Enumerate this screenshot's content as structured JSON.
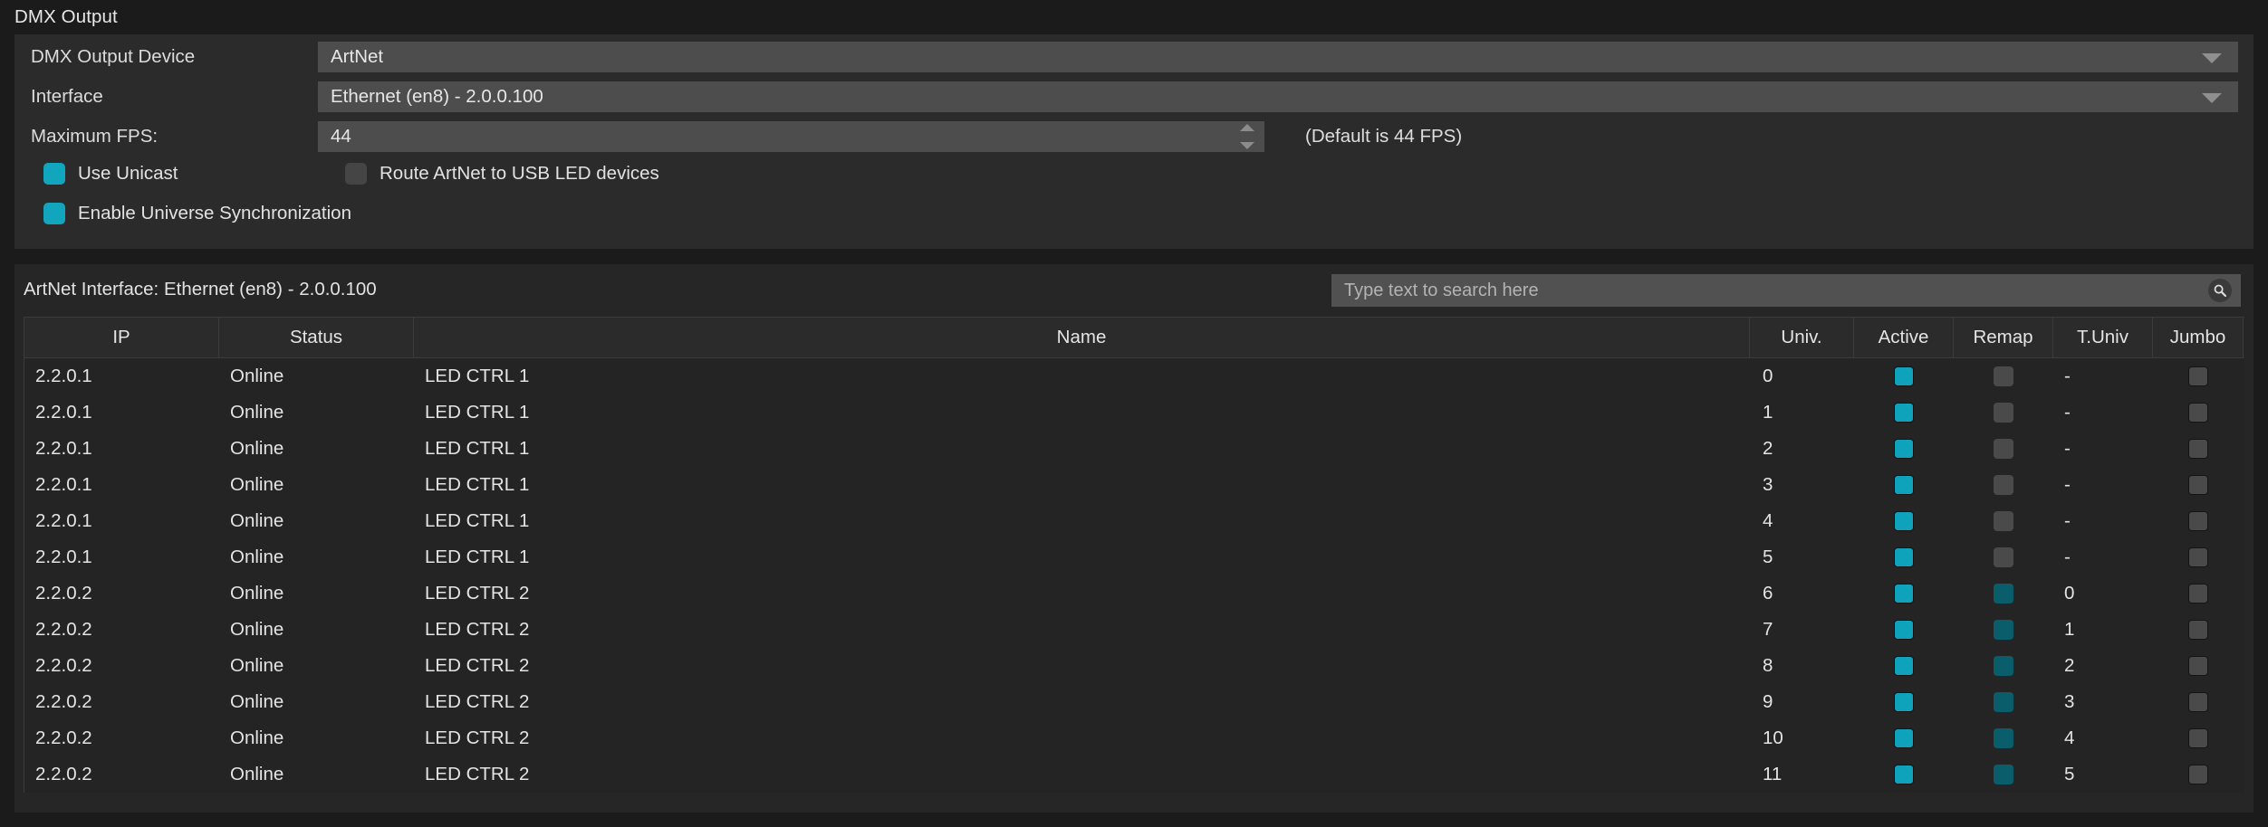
{
  "window": {
    "title": "DMX Output"
  },
  "settings": {
    "device": {
      "label": "DMX Output Device",
      "value": "ArtNet",
      "icon": "chevron-down-icon"
    },
    "interface": {
      "label": "Interface",
      "value": "Ethernet (en8) - 2.0.0.100",
      "icon": "chevron-down-icon"
    },
    "fps": {
      "label": "Maximum FPS:",
      "value": "44",
      "hint": "(Default is 44 FPS)"
    },
    "checkboxes": [
      {
        "label": "Use Unicast",
        "checked": true
      },
      {
        "label": "Route ArtNet to USB LED devices",
        "checked": false
      },
      {
        "label": "Enable Universe Synchronization",
        "checked": true
      }
    ]
  },
  "table": {
    "interface_label": "ArtNet Interface: Ethernet (en8) - 2.0.0.100",
    "search": {
      "placeholder": "Type text to search here",
      "value": "",
      "icon": "search-icon"
    },
    "columns": [
      "IP",
      "Status",
      "Name",
      "Univ.",
      "Active",
      "Remap",
      "T.Univ",
      "Jumbo"
    ],
    "rows": [
      {
        "ip": "2.2.0.1",
        "status": "Online",
        "name": "LED CTRL 1",
        "univ": "0",
        "active": true,
        "remap": false,
        "tuniv": "-",
        "jumbo": false
      },
      {
        "ip": "2.2.0.1",
        "status": "Online",
        "name": "LED CTRL 1",
        "univ": "1",
        "active": true,
        "remap": false,
        "tuniv": "-",
        "jumbo": false
      },
      {
        "ip": "2.2.0.1",
        "status": "Online",
        "name": "LED CTRL 1",
        "univ": "2",
        "active": true,
        "remap": false,
        "tuniv": "-",
        "jumbo": false
      },
      {
        "ip": "2.2.0.1",
        "status": "Online",
        "name": "LED CTRL 1",
        "univ": "3",
        "active": true,
        "remap": false,
        "tuniv": "-",
        "jumbo": false
      },
      {
        "ip": "2.2.0.1",
        "status": "Online",
        "name": "LED CTRL 1",
        "univ": "4",
        "active": true,
        "remap": false,
        "tuniv": "-",
        "jumbo": false
      },
      {
        "ip": "2.2.0.1",
        "status": "Online",
        "name": "LED CTRL 1",
        "univ": "5",
        "active": true,
        "remap": false,
        "tuniv": "-",
        "jumbo": false
      },
      {
        "ip": "2.2.0.2",
        "status": "Online",
        "name": "LED CTRL 2",
        "univ": "6",
        "active": true,
        "remap": true,
        "tuniv": "0",
        "jumbo": false
      },
      {
        "ip": "2.2.0.2",
        "status": "Online",
        "name": "LED CTRL 2",
        "univ": "7",
        "active": true,
        "remap": true,
        "tuniv": "1",
        "jumbo": false
      },
      {
        "ip": "2.2.0.2",
        "status": "Online",
        "name": "LED CTRL 2",
        "univ": "8",
        "active": true,
        "remap": true,
        "tuniv": "2",
        "jumbo": false
      },
      {
        "ip": "2.2.0.2",
        "status": "Online",
        "name": "LED CTRL 2",
        "univ": "9",
        "active": true,
        "remap": true,
        "tuniv": "3",
        "jumbo": false
      },
      {
        "ip": "2.2.0.2",
        "status": "Online",
        "name": "LED CTRL 2",
        "univ": "10",
        "active": true,
        "remap": true,
        "tuniv": "4",
        "jumbo": false
      },
      {
        "ip": "2.2.0.2",
        "status": "Online",
        "name": "LED CTRL 2",
        "univ": "11",
        "active": true,
        "remap": true,
        "tuniv": "5",
        "jumbo": false
      }
    ]
  },
  "colors": {
    "accent_cyan": "#11a6bd",
    "accent_teal_dark": "#0a5e6b",
    "panel_bg": "#2b2b2b",
    "window_bg": "#1b1b1b",
    "field_bg": "#4d4d4d",
    "row_bg": "#242424"
  }
}
